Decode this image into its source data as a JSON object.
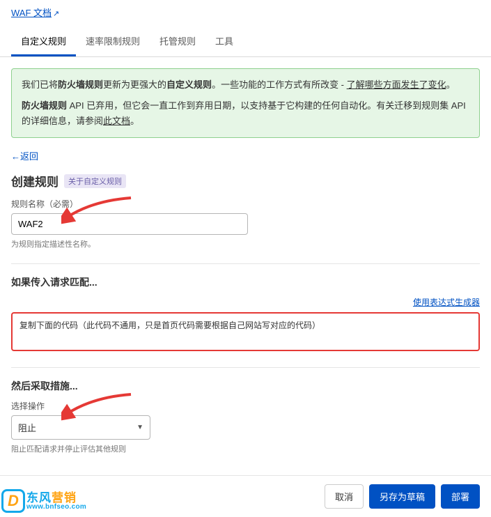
{
  "topLink": "WAF 文档",
  "tabs": [
    "自定义规则",
    "速率限制规则",
    "托管规则",
    "工具"
  ],
  "notice": {
    "line1_a": "我们已将",
    "line1_b": "防火墙规则",
    "line1_c": "更新为更强大的",
    "line1_d": "自定义规则",
    "line1_e": "。一些功能的工作方式有所改变 - ",
    "line1_link": "了解哪些方面发生了变化",
    "line1_f": "。",
    "line2_a": "防火墙规则",
    "line2_b": " API 已弃用，但它会一直工作到弃用日期，以支持基于它构建的任何自动化。有关迁移到规则集 API 的详细信息，请参阅",
    "line2_link": "此文档",
    "line2_c": "。"
  },
  "backLink": "←返回",
  "createRule": {
    "title": "创建规则",
    "badge": "关于自定义规则",
    "nameLabel": "规则名称（必需）",
    "nameValue": "WAF2",
    "nameHelper": "为规则指定描述性名称。"
  },
  "match": {
    "title": "如果传入请求匹配...",
    "builderLink": "使用表达式生成器",
    "codeValue": "复制下面的代码（此代码不通用，只是首页代码需要根据自己网站写对应的代码）"
  },
  "action": {
    "title": "然后采取措施...",
    "selectLabel": "选择操作",
    "selectValue": "阻止",
    "helper": "阻止匹配请求并停止评估其他规则"
  },
  "footer": {
    "cancel": "取消",
    "draft": "另存为草稿",
    "deploy": "部署"
  },
  "watermark": {
    "cn1": "东风",
    "cn2": "营销",
    "url": "www.bnfseo.com",
    "logo": "D"
  }
}
